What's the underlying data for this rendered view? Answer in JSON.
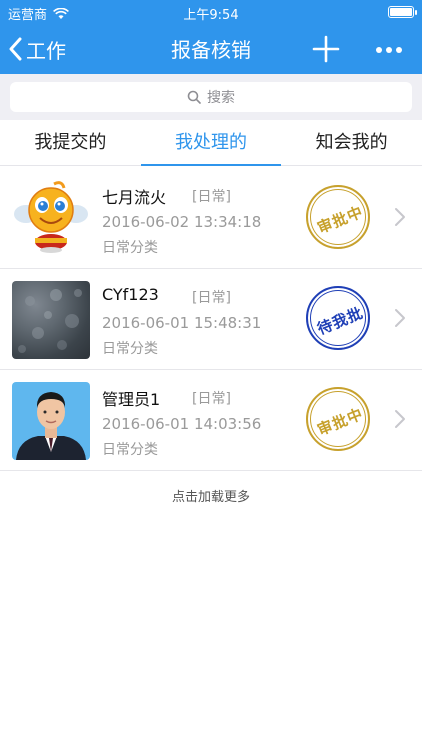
{
  "status_bar": {
    "carrier": "运营商",
    "time": "上午9:54"
  },
  "nav": {
    "back_label": "工作",
    "title": "报备核销"
  },
  "search": {
    "placeholder": "搜索"
  },
  "tabs": [
    {
      "label": "我提交的",
      "active": false
    },
    {
      "label": "我处理的",
      "active": true
    },
    {
      "label": "知会我的",
      "active": false
    }
  ],
  "items": [
    {
      "name": "七月流火",
      "tag": "[日常]",
      "date": "2016-06-02 13:34:18",
      "category": "日常分类",
      "stamp": "审批中",
      "stamp_color": "#c7a12d",
      "avatar": "cartoon-smiley-avatar"
    },
    {
      "name": "CYf123",
      "tag": "[日常]",
      "date": "2016-06-01 15:48:31",
      "category": "日常分类",
      "stamp": "待我批",
      "stamp_color": "#1f3fb6",
      "avatar": "shadow-photo-avatar"
    },
    {
      "name": "管理员1",
      "tag": "[日常]",
      "date": "2016-06-01 14:03:56",
      "category": "日常分类",
      "stamp": "审批中",
      "stamp_color": "#c7a12d",
      "avatar": "person-portrait-avatar"
    }
  ],
  "load_more": "点击加载更多",
  "colors": {
    "primary": "#2f95ec",
    "background": "#efeff4"
  }
}
